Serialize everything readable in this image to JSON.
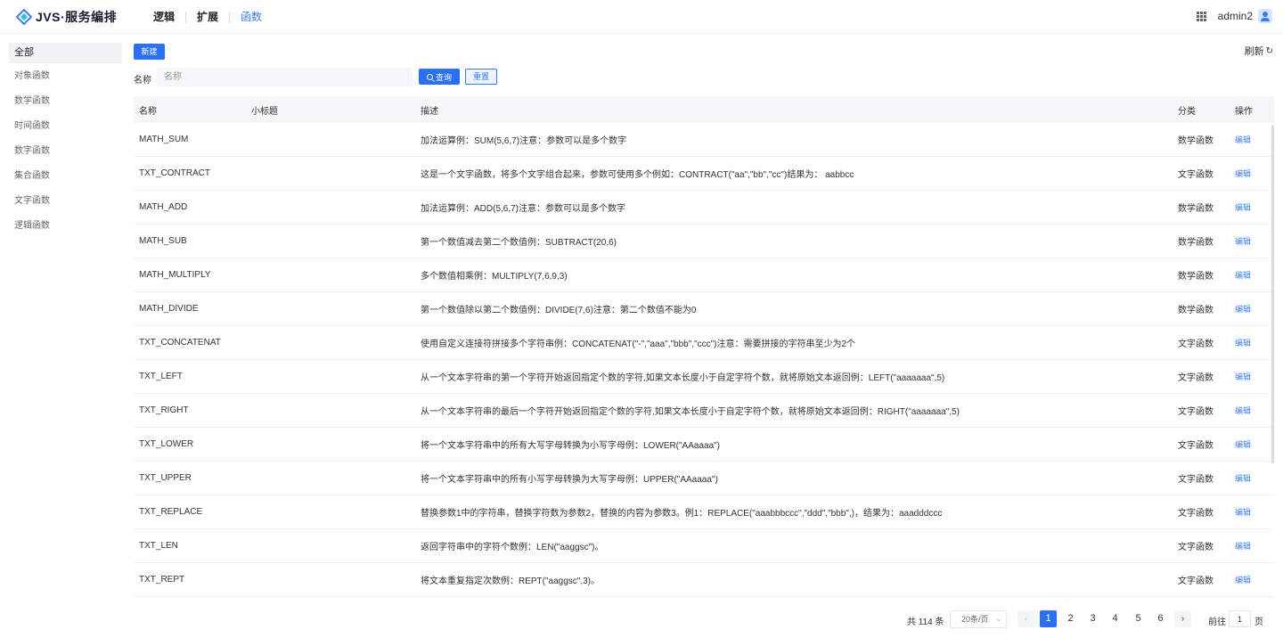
{
  "app": {
    "title": "JVS·服务编排",
    "user": "admin2"
  },
  "nav": {
    "items": [
      {
        "label": "逻辑",
        "active": false
      },
      {
        "label": "扩展",
        "active": false
      },
      {
        "label": "函数",
        "active": true
      }
    ]
  },
  "sidebar": {
    "items": [
      {
        "label": "全部",
        "active": true
      },
      {
        "label": "对象函数"
      },
      {
        "label": "数学函数"
      },
      {
        "label": "时间函数"
      },
      {
        "label": "数字函数"
      },
      {
        "label": "集合函数"
      },
      {
        "label": "文字函数"
      },
      {
        "label": "逻辑函数"
      }
    ]
  },
  "toolbar": {
    "new_label": "新建",
    "refresh_label": "刷新",
    "refresh_icon": "refresh-icon"
  },
  "filter": {
    "label": "名称",
    "placeholder": "名称",
    "value": "",
    "query_label": "查询",
    "reset_label": "重置"
  },
  "table": {
    "columns": {
      "name": "名称",
      "subtitle": "小标题",
      "desc": "描述",
      "category": "分类",
      "op": "操作"
    },
    "edit_label": "编辑",
    "rows": [
      {
        "name": "MATH_SUM",
        "subtitle": "",
        "desc": "加法运算例：SUM(5,6,7)注意：参数可以是多个数字",
        "category": "数学函数"
      },
      {
        "name": "TXT_CONTRACT",
        "subtitle": "",
        "desc": "这是一个文字函数，将多个文字组合起来，参数可使用多个例如：CONTRACT(\"aa\",\"bb\",\"cc\")结果为： aabbcc",
        "category": "文字函数"
      },
      {
        "name": "MATH_ADD",
        "subtitle": "",
        "desc": "加法运算例：ADD(5,6,7)注意：参数可以是多个数字",
        "category": "数学函数"
      },
      {
        "name": "MATH_SUB",
        "subtitle": "",
        "desc": "第一个数值减去第二个数值例：SUBTRACT(20,6)",
        "category": "数学函数"
      },
      {
        "name": "MATH_MULTIPLY",
        "subtitle": "",
        "desc": "多个数值相乘例：MULTIPLY(7,6,9,3)",
        "category": "数学函数"
      },
      {
        "name": "MATH_DIVIDE",
        "subtitle": "",
        "desc": "第一个数值除以第二个数值例：DIVIDE(7,6)注意：第二个数值不能为0",
        "category": "数学函数"
      },
      {
        "name": "TXT_CONCATENAT",
        "subtitle": "",
        "desc": "使用自定义连接符拼接多个字符串例：CONCATENAT(\"-\",\"aaa\",\"bbb\",\"ccc\")注意：需要拼接的字符串至少为2个",
        "category": "文字函数"
      },
      {
        "name": "TXT_LEFT",
        "subtitle": "",
        "desc": "从一个文本字符串的第一个字符开始返回指定个数的字符,如果文本长度小于自定字符个数，就将原始文本返回例：LEFT(\"aaaaaaa\",5)",
        "category": "文字函数"
      },
      {
        "name": "TXT_RIGHT",
        "subtitle": "",
        "desc": "从一个文本字符串的最后一个字符开始返回指定个数的字符,如果文本长度小于自定字符个数，就将原始文本返回例：RIGHT(\"aaaaaaa\",5)",
        "category": "文字函数"
      },
      {
        "name": "TXT_LOWER",
        "subtitle": "",
        "desc": "将一个文本字符串中的所有大写字母转换为小写字母例：LOWER(\"AAaaaa\")",
        "category": "文字函数"
      },
      {
        "name": "TXT_UPPER",
        "subtitle": "",
        "desc": "将一个文本字符串中的所有小写字母转换为大写字母例：UPPER(\"AAaaaa\")",
        "category": "文字函数"
      },
      {
        "name": "TXT_REPLACE",
        "subtitle": "",
        "desc": "替换参数1中的字符串，替换字符数为参数2，替换的内容为参数3。例1：REPLACE(\"aaabbbccc\",\"ddd\",\"bbb\",)，结果为：aaadddccc",
        "category": "文字函数"
      },
      {
        "name": "TXT_LEN",
        "subtitle": "",
        "desc": "返回字符串中的字符个数例：LEN(\"aaggsc\")。",
        "category": "文字函数"
      },
      {
        "name": "TXT_REPT",
        "subtitle": "",
        "desc": "将文本重复指定次数例：REPT(\"aaggsc\",3)。",
        "category": "文字函数"
      }
    ]
  },
  "pagination": {
    "total_text": "共 114 条",
    "page_size": "20条/页",
    "pages": [
      "1",
      "2",
      "3",
      "4",
      "5",
      "6"
    ],
    "current": "1",
    "goto_label": "前往",
    "goto_value": "1",
    "goto_unit": "页"
  }
}
